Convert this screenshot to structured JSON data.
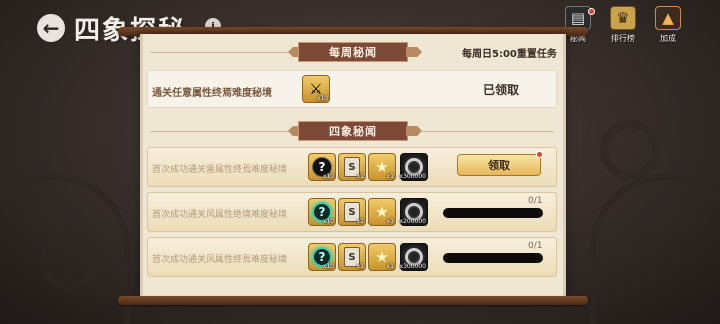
{
  "header": {
    "title": "四象探秘",
    "back_icon": "arrow-left-icon",
    "info_icon": "info-icon",
    "buttons": [
      {
        "label": "秘闻",
        "icon": "scroll-book-icon"
      },
      {
        "label": "排行榜",
        "icon": "trophy-icon"
      },
      {
        "label": "加成",
        "icon": "boost-icon"
      }
    ]
  },
  "weekly": {
    "banner": "每周秘闻",
    "reset_note": "每周日5:00重置任务",
    "task": {
      "text": "通关任意属性终焉难度秘境",
      "rewards": [
        {
          "icon": "sword-icon",
          "qty": "x10"
        }
      ],
      "status": "已领取"
    }
  },
  "sixiang": {
    "banner": "四象秘闻",
    "tasks": [
      {
        "text": "首次成功通关雷属性终焉难度秘境",
        "rewards": [
          {
            "icon": "mystery-orb-icon",
            "qty": "x10"
          },
          {
            "icon": "scroll-icon",
            "qty": "x1"
          },
          {
            "icon": "gold-key-icon",
            "qty": "x1"
          },
          {
            "icon": "coin-icon",
            "qty": "x300000"
          }
        ],
        "claim_label": "领取",
        "progress": "",
        "progress_fraction": 1.0
      },
      {
        "text": "首次成功通关风属性绝境难度秘境",
        "rewards": [
          {
            "icon": "mystery-orb-teal-icon",
            "qty": "x10"
          },
          {
            "icon": "scroll-icon",
            "qty": "x2"
          },
          {
            "icon": "gold-key-icon",
            "qty": "x1"
          },
          {
            "icon": "coin-icon",
            "qty": "x200000"
          }
        ],
        "claim_label": "",
        "progress": "0/1",
        "progress_fraction": 0.0
      },
      {
        "text": "首次成功通关风属性终焉难度秘境",
        "rewards": [
          {
            "icon": "mystery-orb-teal-icon",
            "qty": "x10"
          },
          {
            "icon": "scroll-icon",
            "qty": "x1"
          },
          {
            "icon": "gold-key-icon",
            "qty": "x1"
          },
          {
            "icon": "coin-icon",
            "qty": "x300000"
          }
        ],
        "claim_label": "",
        "progress": "0/1",
        "progress_fraction": 0.0
      }
    ]
  },
  "colors": {
    "panel": "#efe6d3",
    "banner": "#7c4a36",
    "claim_button": "#e6b75a",
    "progress_track": "#0e0c0b",
    "notification": "#e0402b"
  }
}
